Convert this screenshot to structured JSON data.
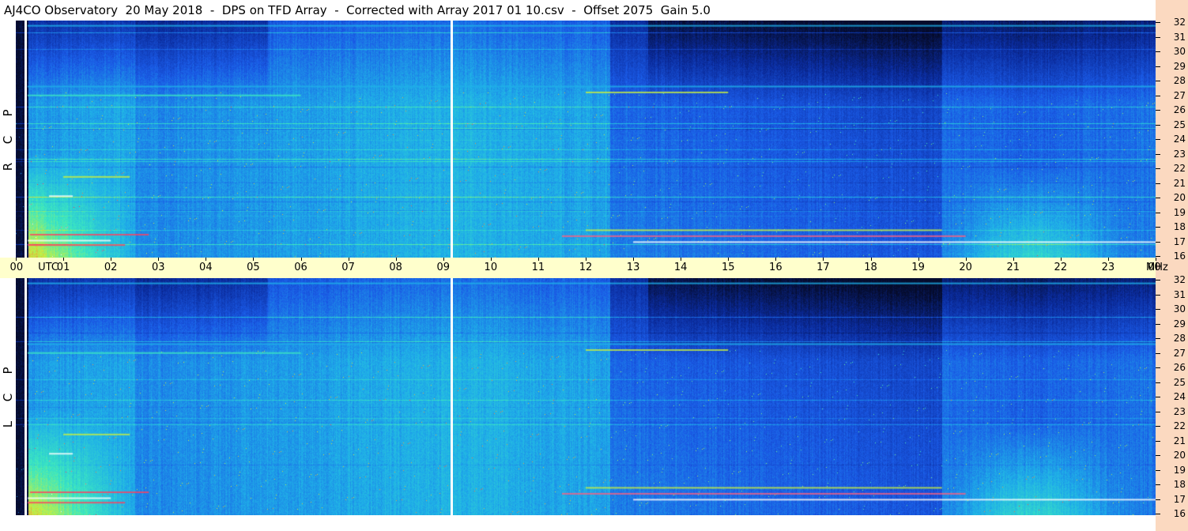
{
  "header": {
    "title": "AJ4CO Observatory  20 May 2018  -  DPS on TFD Array  -  Corrected with Array 2017 01 10.csv  -  Offset 2075  Gain 5.0"
  },
  "panels": [
    {
      "id": "rcp",
      "label_letters": [
        "R",
        "C",
        "P"
      ]
    },
    {
      "id": "lcp",
      "label_letters": [
        "L",
        "C",
        "P"
      ]
    }
  ],
  "time_axis": {
    "labels": [
      "00",
      "UTC",
      "01",
      "02",
      "03",
      "04",
      "05",
      "06",
      "07",
      "08",
      "09",
      "10",
      "11",
      "12",
      "13",
      "14",
      "15",
      "16",
      "17",
      "18",
      "19",
      "20",
      "21",
      "22",
      "23",
      "00",
      "MHz"
    ]
  },
  "chart_data": {
    "type": "heatmap",
    "title": "AJ4CO Observatory  20 May 2018  -  DPS on TFD Array  -  Corrected with Array 2017 01 10.csv  -  Offset 2075  Gain 5.0",
    "x_unit": "UTC",
    "y_unit": "MHz",
    "x_range": [
      0,
      24
    ],
    "y_range": [
      16,
      32
    ],
    "x_ticks": [
      "00",
      "01",
      "02",
      "03",
      "04",
      "05",
      "06",
      "07",
      "08",
      "09",
      "10",
      "11",
      "12",
      "13",
      "14",
      "15",
      "16",
      "17",
      "18",
      "19",
      "20",
      "21",
      "22",
      "23",
      "00"
    ],
    "y_ticks": [
      16,
      17,
      18,
      19,
      20,
      21,
      22,
      23,
      24,
      25,
      26,
      27,
      28,
      29,
      30,
      31,
      32
    ],
    "series": [
      {
        "name": "R C P"
      },
      {
        "name": "L C P"
      }
    ],
    "markers_utc": [
      0.2,
      9.15
    ],
    "colormap": [
      "#050b2a",
      "#0a2a9a",
      "#1a5ae6",
      "#1fb0e8",
      "#3ce8c0",
      "#c8f040",
      "#ff3050",
      "#ffffff"
    ]
  },
  "colors": {
    "timebar": "#ffffcc",
    "axis_bg": "#fbd9c0"
  }
}
